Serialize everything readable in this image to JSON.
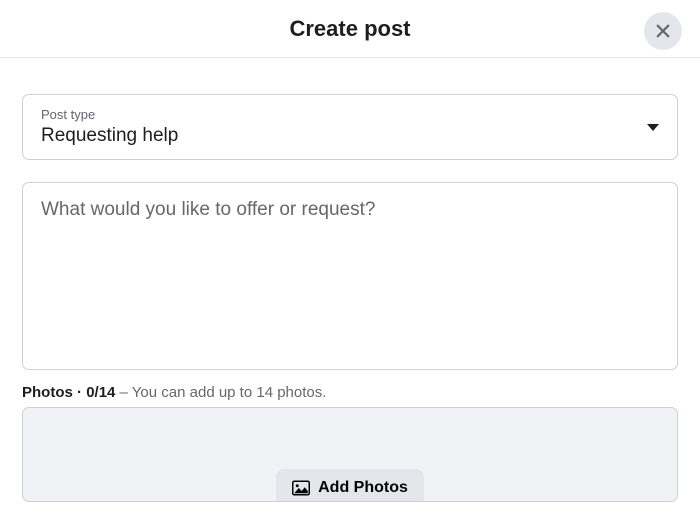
{
  "header": {
    "title": "Create post"
  },
  "postType": {
    "label": "Post type",
    "value": "Requesting help"
  },
  "textarea": {
    "placeholder": "What would you like to offer or request?"
  },
  "photos": {
    "label": "Photos",
    "separator": " · ",
    "count": "0/14",
    "hint": " – You can add up to 14 photos.",
    "addButton": "Add Photos"
  }
}
